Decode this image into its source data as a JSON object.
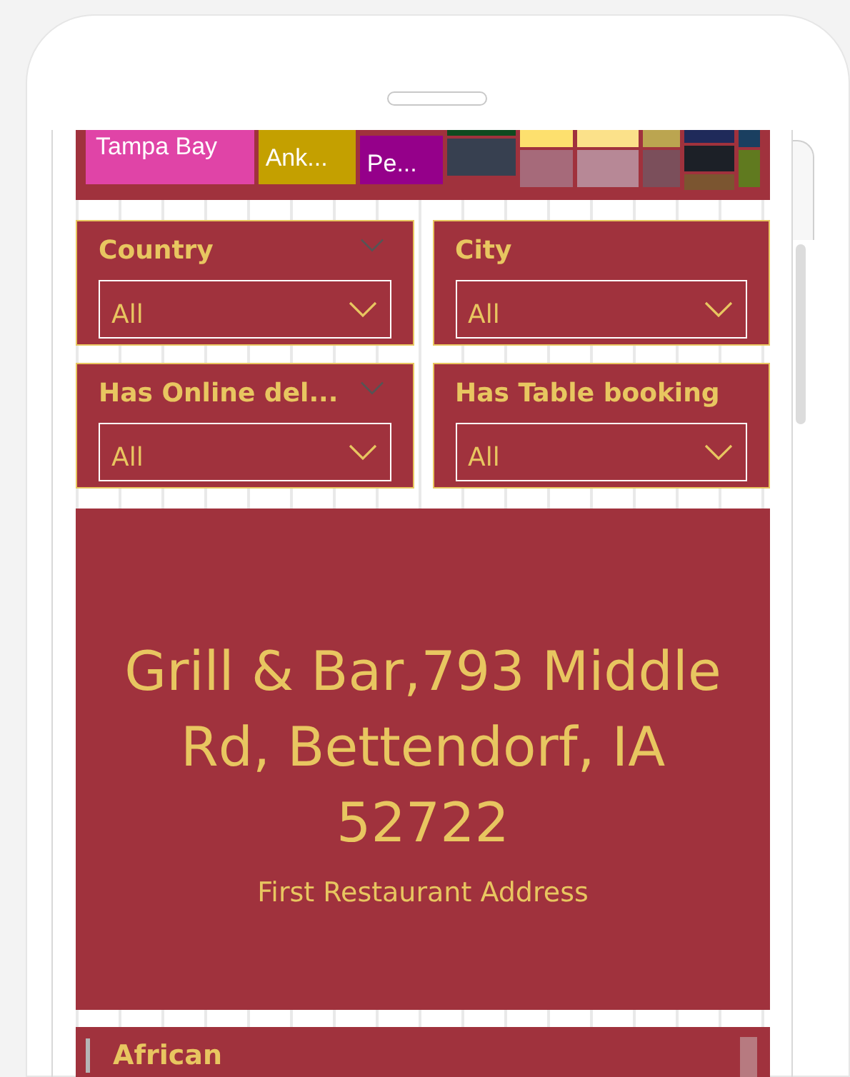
{
  "treemap": {
    "columns": [
      {
        "tiles": [
          {
            "label": "Tampa Bay",
            "color": "#e044a7"
          }
        ]
      },
      {
        "tiles": [
          {
            "label": "Ank...",
            "color": "#c4a000"
          }
        ]
      },
      {
        "tiles": [
          {
            "label": "Pe...",
            "color": "#95008a"
          }
        ]
      },
      {
        "tiles": [
          {
            "color": "#0f4a1f"
          },
          {
            "color": "#374050"
          }
        ]
      },
      {
        "tiles": [
          {
            "color": "#fde06e"
          },
          {
            "color": "#a66a7a"
          }
        ]
      },
      {
        "tiles": [
          {
            "color": "#fbe18a"
          },
          {
            "color": "#b78896"
          }
        ]
      },
      {
        "tiles": [
          {
            "color": "#bba550"
          },
          {
            "color": "#7b4f5b"
          }
        ]
      },
      {
        "tiles": [
          {
            "color": "#1f2a5a"
          },
          {
            "color": "#1c2027"
          },
          {
            "color": "#7b5530"
          }
        ]
      },
      {
        "tiles": [
          {
            "color": "#1a3f60"
          },
          {
            "color": "#607a1f"
          }
        ]
      }
    ]
  },
  "slicers": [
    {
      "title": "Country",
      "value": "All",
      "header_chevron": true
    },
    {
      "title": "City",
      "value": "All",
      "header_chevron": false
    },
    {
      "title": "Has Online del...",
      "value": "All",
      "header_chevron": true
    },
    {
      "title": "Has Table booking",
      "value": "All",
      "header_chevron": false
    }
  ],
  "card": {
    "value": "Grill & Bar,793 Middle Rd, Bettendorf, IA 52722",
    "label": "First Restaurant Address"
  },
  "list": {
    "items": [
      {
        "label": "African"
      }
    ]
  }
}
